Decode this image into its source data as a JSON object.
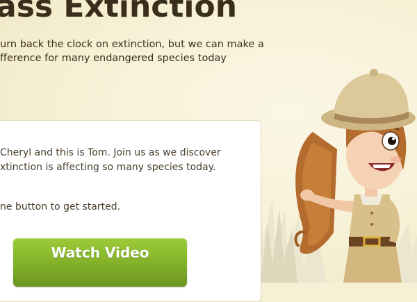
{
  "header": {
    "title": "ass Extinction",
    "subtitle_lines": [
      "urn back the clock on extinction, but we can make a",
      "fference for many endangered species today"
    ]
  },
  "panel": {
    "intro_lines": [
      "Cheryl and this is Tom. Join us as we discover",
      "xtinction is affecting so many species today."
    ],
    "cta_text": "ne button to get started.",
    "watch_button_label": "Watch Video"
  },
  "illustration": {
    "character_icon": "explorer-girl-icon",
    "grass_icon": "grass-icon"
  },
  "colors": {
    "background": "#f6f0d4",
    "heading": "#3a2d1c",
    "button_green": "#86b52b",
    "panel": "#ffffff"
  }
}
